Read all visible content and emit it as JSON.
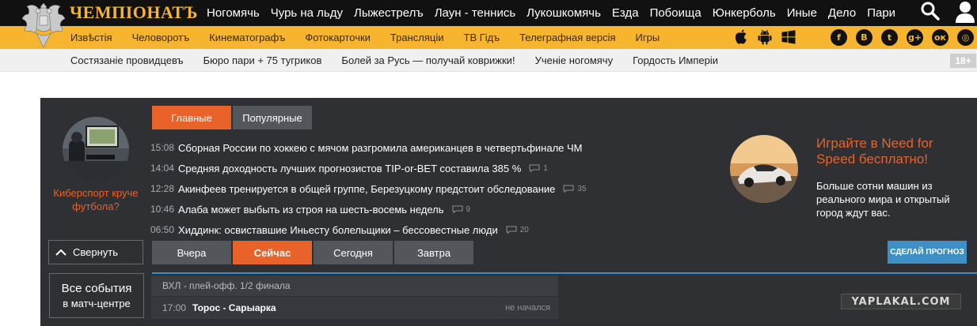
{
  "header": {
    "logo_text": "ЧЕМПIОНАТЪ",
    "nav": [
      "Ногомячь",
      "Чурь на льду",
      "Лыжестрелъ",
      "Лаун - теннись",
      "Лукошкомячь",
      "Езда",
      "Побоища",
      "Юнкерболь",
      "Иные",
      "Дело",
      "Пари"
    ],
    "icons": {
      "search": "search-icon",
      "user": "user-icon"
    }
  },
  "subnav": {
    "items": [
      "Извѣстія",
      "Человоротъ",
      "Кинематографъ",
      "Фотокарточки",
      "Трансляціи",
      "ТВ Гідъ",
      "Телеграфная версія",
      "Игры"
    ],
    "platform_icons": [
      "apple-icon",
      "android-icon",
      "windows-icon"
    ],
    "socials": [
      {
        "icon": "facebook-icon",
        "glyph": "f"
      },
      {
        "icon": "vk-icon",
        "glyph": "B"
      },
      {
        "icon": "twitter-icon",
        "glyph": "t"
      },
      {
        "icon": "googleplus-icon",
        "glyph": "g+"
      },
      {
        "icon": "odnoklassniki-icon",
        "glyph": "ок"
      },
      {
        "icon": "instagram-icon",
        "glyph": "◎"
      }
    ]
  },
  "promobar": {
    "links": [
      "Состязаніе провидцевъ",
      "Бюро пари + 75 тугриков",
      "Болей за Русь — получай коврижки!",
      "Ученіе ногомячу",
      "Гордость Имперіи"
    ],
    "age_badge": "18+"
  },
  "left_promo": {
    "caption": "Киберспорт круче футбола?"
  },
  "news_tabs": [
    {
      "label": "Главные",
      "active": true
    },
    {
      "label": "Популярные",
      "active": false
    }
  ],
  "news": [
    {
      "time": "15:08",
      "title": "Сборная России по хоккею с мячом разгромила американцев в четвертьфинале ЧМ",
      "comments": ""
    },
    {
      "time": "14:04",
      "title": "Средняя доходность лучших прогнозистов TIP-or-BET составила 385 %",
      "comments": "1"
    },
    {
      "time": "12:28",
      "title": "Акинфеев тренируется в общей группе, Березуцкому предстоит обследование",
      "comments": "35"
    },
    {
      "time": "10:46",
      "title": "Алаба может выбыть из строя на шесть-восемь недель",
      "comments": "9"
    },
    {
      "time": "06:50",
      "title": "Хиддинк: освиставшие Иньесту болельщики – бессовестные люди",
      "comments": "20"
    }
  ],
  "right_promo": {
    "title": "Играйте в Need for Speed бесплатно!",
    "text": "Больше сотни машин из реального мира и открытый город ждут вас."
  },
  "match_center": {
    "collapse_label": "Свернуть",
    "day_tabs": [
      {
        "label": "Вчера",
        "active": false
      },
      {
        "label": "Сейчас",
        "active": true
      },
      {
        "label": "Сегодня",
        "active": false
      },
      {
        "label": "Завтра",
        "active": false
      }
    ],
    "forecast_label": "СДЕЛАЙ ПРОГНОЗ",
    "all_events_line1": "Все события",
    "all_events_line2": "в матч-центре",
    "league": "ВХЛ - плей-офф. 1/2 финала",
    "matches": [
      {
        "time": "17:00",
        "teams": "Торос - Сарыарка",
        "status": "не начался"
      }
    ]
  },
  "watermark": "YAPLAKAL.COM",
  "colors": {
    "accent": "#e8622a",
    "brand_yellow": "#f7b52f",
    "panel": "#2e3033",
    "blue": "#3d8fc6"
  }
}
